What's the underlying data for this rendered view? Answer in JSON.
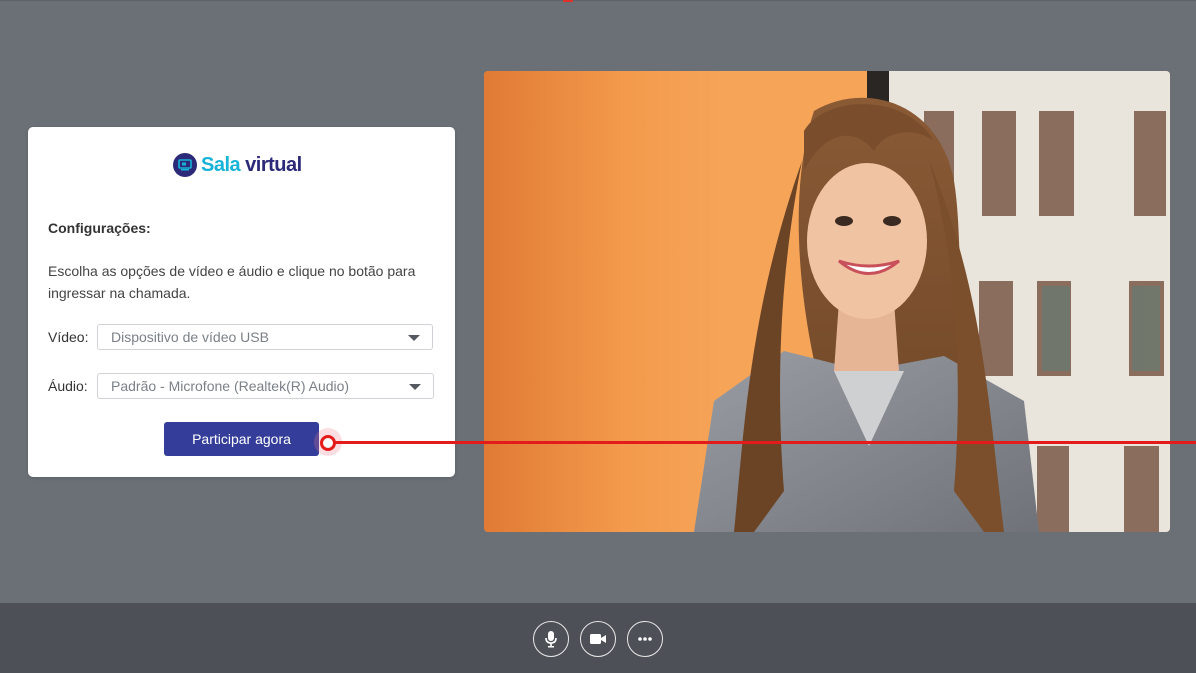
{
  "brand": {
    "name_part1": "Sala",
    "name_part2": "virtual",
    "accent_color": "#16b3d8",
    "primary_color": "#2c2a78"
  },
  "settings": {
    "title": "Configurações:",
    "instructions": "Escolha as opções de vídeo e áudio e clique no botão para ingressar na chamada.",
    "video_label": "Vídeo:",
    "video_selected": "Dispositivo de vídeo USB",
    "audio_label": "Áudio:",
    "audio_selected": "Padrão - Microfone (Realtek(R) Audio)",
    "join_label": "Participar agora"
  },
  "controls": [
    {
      "name": "microphone",
      "icon": "microphone-icon"
    },
    {
      "name": "camera",
      "icon": "video-camera-icon"
    },
    {
      "name": "more",
      "icon": "more-options-icon"
    }
  ],
  "colors": {
    "background": "#6a7076",
    "bottom_bar": "#4d5157",
    "join_button": "#343e9a",
    "cursor_trail": "#e41b1b"
  }
}
